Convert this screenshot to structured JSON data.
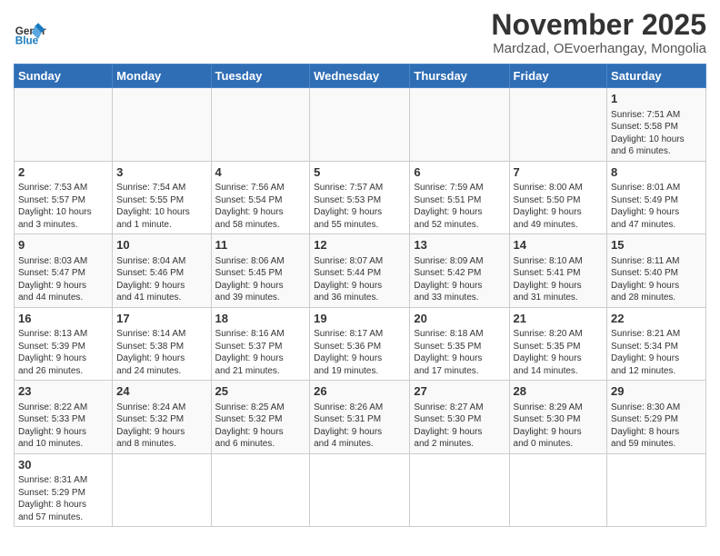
{
  "header": {
    "logo_general": "General",
    "logo_blue": "Blue",
    "month_title": "November 2025",
    "subtitle": "Mardzad, OEvoerhangay, Mongolia"
  },
  "weekdays": [
    "Sunday",
    "Monday",
    "Tuesday",
    "Wednesday",
    "Thursday",
    "Friday",
    "Saturday"
  ],
  "weeks": [
    [
      {
        "day": "",
        "info": ""
      },
      {
        "day": "",
        "info": ""
      },
      {
        "day": "",
        "info": ""
      },
      {
        "day": "",
        "info": ""
      },
      {
        "day": "",
        "info": ""
      },
      {
        "day": "",
        "info": ""
      },
      {
        "day": "1",
        "info": "Sunrise: 7:51 AM\nSunset: 5:58 PM\nDaylight: 10 hours\nand 6 minutes."
      }
    ],
    [
      {
        "day": "2",
        "info": "Sunrise: 7:53 AM\nSunset: 5:57 PM\nDaylight: 10 hours\nand 3 minutes."
      },
      {
        "day": "3",
        "info": "Sunrise: 7:54 AM\nSunset: 5:55 PM\nDaylight: 10 hours\nand 1 minute."
      },
      {
        "day": "4",
        "info": "Sunrise: 7:56 AM\nSunset: 5:54 PM\nDaylight: 9 hours\nand 58 minutes."
      },
      {
        "day": "5",
        "info": "Sunrise: 7:57 AM\nSunset: 5:53 PM\nDaylight: 9 hours\nand 55 minutes."
      },
      {
        "day": "6",
        "info": "Sunrise: 7:59 AM\nSunset: 5:51 PM\nDaylight: 9 hours\nand 52 minutes."
      },
      {
        "day": "7",
        "info": "Sunrise: 8:00 AM\nSunset: 5:50 PM\nDaylight: 9 hours\nand 49 minutes."
      },
      {
        "day": "8",
        "info": "Sunrise: 8:01 AM\nSunset: 5:49 PM\nDaylight: 9 hours\nand 47 minutes."
      }
    ],
    [
      {
        "day": "9",
        "info": "Sunrise: 8:03 AM\nSunset: 5:47 PM\nDaylight: 9 hours\nand 44 minutes."
      },
      {
        "day": "10",
        "info": "Sunrise: 8:04 AM\nSunset: 5:46 PM\nDaylight: 9 hours\nand 41 minutes."
      },
      {
        "day": "11",
        "info": "Sunrise: 8:06 AM\nSunset: 5:45 PM\nDaylight: 9 hours\nand 39 minutes."
      },
      {
        "day": "12",
        "info": "Sunrise: 8:07 AM\nSunset: 5:44 PM\nDaylight: 9 hours\nand 36 minutes."
      },
      {
        "day": "13",
        "info": "Sunrise: 8:09 AM\nSunset: 5:42 PM\nDaylight: 9 hours\nand 33 minutes."
      },
      {
        "day": "14",
        "info": "Sunrise: 8:10 AM\nSunset: 5:41 PM\nDaylight: 9 hours\nand 31 minutes."
      },
      {
        "day": "15",
        "info": "Sunrise: 8:11 AM\nSunset: 5:40 PM\nDaylight: 9 hours\nand 28 minutes."
      }
    ],
    [
      {
        "day": "16",
        "info": "Sunrise: 8:13 AM\nSunset: 5:39 PM\nDaylight: 9 hours\nand 26 minutes."
      },
      {
        "day": "17",
        "info": "Sunrise: 8:14 AM\nSunset: 5:38 PM\nDaylight: 9 hours\nand 24 minutes."
      },
      {
        "day": "18",
        "info": "Sunrise: 8:16 AM\nSunset: 5:37 PM\nDaylight: 9 hours\nand 21 minutes."
      },
      {
        "day": "19",
        "info": "Sunrise: 8:17 AM\nSunset: 5:36 PM\nDaylight: 9 hours\nand 19 minutes."
      },
      {
        "day": "20",
        "info": "Sunrise: 8:18 AM\nSunset: 5:35 PM\nDaylight: 9 hours\nand 17 minutes."
      },
      {
        "day": "21",
        "info": "Sunrise: 8:20 AM\nSunset: 5:35 PM\nDaylight: 9 hours\nand 14 minutes."
      },
      {
        "day": "22",
        "info": "Sunrise: 8:21 AM\nSunset: 5:34 PM\nDaylight: 9 hours\nand 12 minutes."
      }
    ],
    [
      {
        "day": "23",
        "info": "Sunrise: 8:22 AM\nSunset: 5:33 PM\nDaylight: 9 hours\nand 10 minutes."
      },
      {
        "day": "24",
        "info": "Sunrise: 8:24 AM\nSunset: 5:32 PM\nDaylight: 9 hours\nand 8 minutes."
      },
      {
        "day": "25",
        "info": "Sunrise: 8:25 AM\nSunset: 5:32 PM\nDaylight: 9 hours\nand 6 minutes."
      },
      {
        "day": "26",
        "info": "Sunrise: 8:26 AM\nSunset: 5:31 PM\nDaylight: 9 hours\nand 4 minutes."
      },
      {
        "day": "27",
        "info": "Sunrise: 8:27 AM\nSunset: 5:30 PM\nDaylight: 9 hours\nand 2 minutes."
      },
      {
        "day": "28",
        "info": "Sunrise: 8:29 AM\nSunset: 5:30 PM\nDaylight: 9 hours\nand 0 minutes."
      },
      {
        "day": "29",
        "info": "Sunrise: 8:30 AM\nSunset: 5:29 PM\nDaylight: 8 hours\nand 59 minutes."
      }
    ],
    [
      {
        "day": "30",
        "info": "Sunrise: 8:31 AM\nSunset: 5:29 PM\nDaylight: 8 hours\nand 57 minutes."
      },
      {
        "day": "",
        "info": ""
      },
      {
        "day": "",
        "info": ""
      },
      {
        "day": "",
        "info": ""
      },
      {
        "day": "",
        "info": ""
      },
      {
        "day": "",
        "info": ""
      },
      {
        "day": "",
        "info": ""
      }
    ]
  ]
}
